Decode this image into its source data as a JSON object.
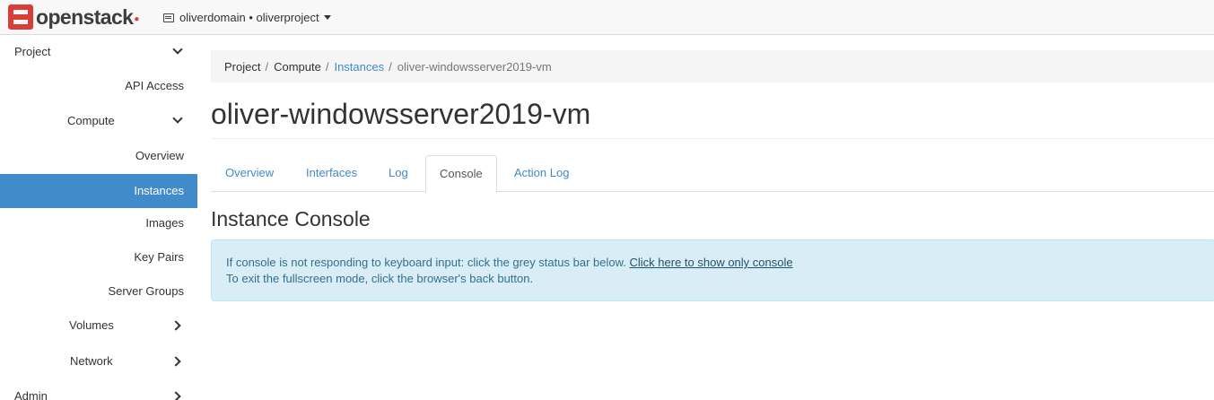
{
  "navbar": {
    "brand": "openstack",
    "project_selector": "oliverdomain • oliverproject"
  },
  "sidebar": {
    "items": [
      {
        "label": "Project",
        "name": "sidebar-item-project",
        "expanded": true
      },
      {
        "label": "API Access",
        "name": "sidebar-item-api-access"
      },
      {
        "label": "Compute",
        "name": "sidebar-item-compute",
        "expanded": true
      },
      {
        "label": "Overview",
        "name": "sidebar-item-overview"
      },
      {
        "label": "Instances",
        "name": "sidebar-item-instances",
        "active": true
      },
      {
        "label": "Images",
        "name": "sidebar-item-images"
      },
      {
        "label": "Key Pairs",
        "name": "sidebar-item-key-pairs"
      },
      {
        "label": "Server Groups",
        "name": "sidebar-item-server-groups"
      },
      {
        "label": "Volumes",
        "name": "sidebar-item-volumes",
        "expanded": false
      },
      {
        "label": "Network",
        "name": "sidebar-item-network",
        "expanded": false
      },
      {
        "label": "Admin",
        "name": "sidebar-item-admin",
        "expanded": false
      }
    ]
  },
  "breadcrumb": {
    "items": [
      "Project",
      "Compute",
      "Instances",
      "oliver-windowsserver2019-vm"
    ]
  },
  "page": {
    "title": "oliver-windowsserver2019-vm"
  },
  "tabs": [
    "Overview",
    "Interfaces",
    "Log",
    "Console",
    "Action Log"
  ],
  "active_tab": "Console",
  "console": {
    "heading": "Instance Console",
    "line1": "If console is not responding to keyboard input: click the grey status bar below.",
    "link": "Click here to show only console",
    "line2": "To exit the fullscreen mode, click the browser's back button."
  },
  "colors": {
    "active_nav": "#428bca",
    "link": "#428bca",
    "alert_bg": "#d9edf7",
    "alert_text": "#31708f",
    "brand_red": "#d93d38"
  }
}
